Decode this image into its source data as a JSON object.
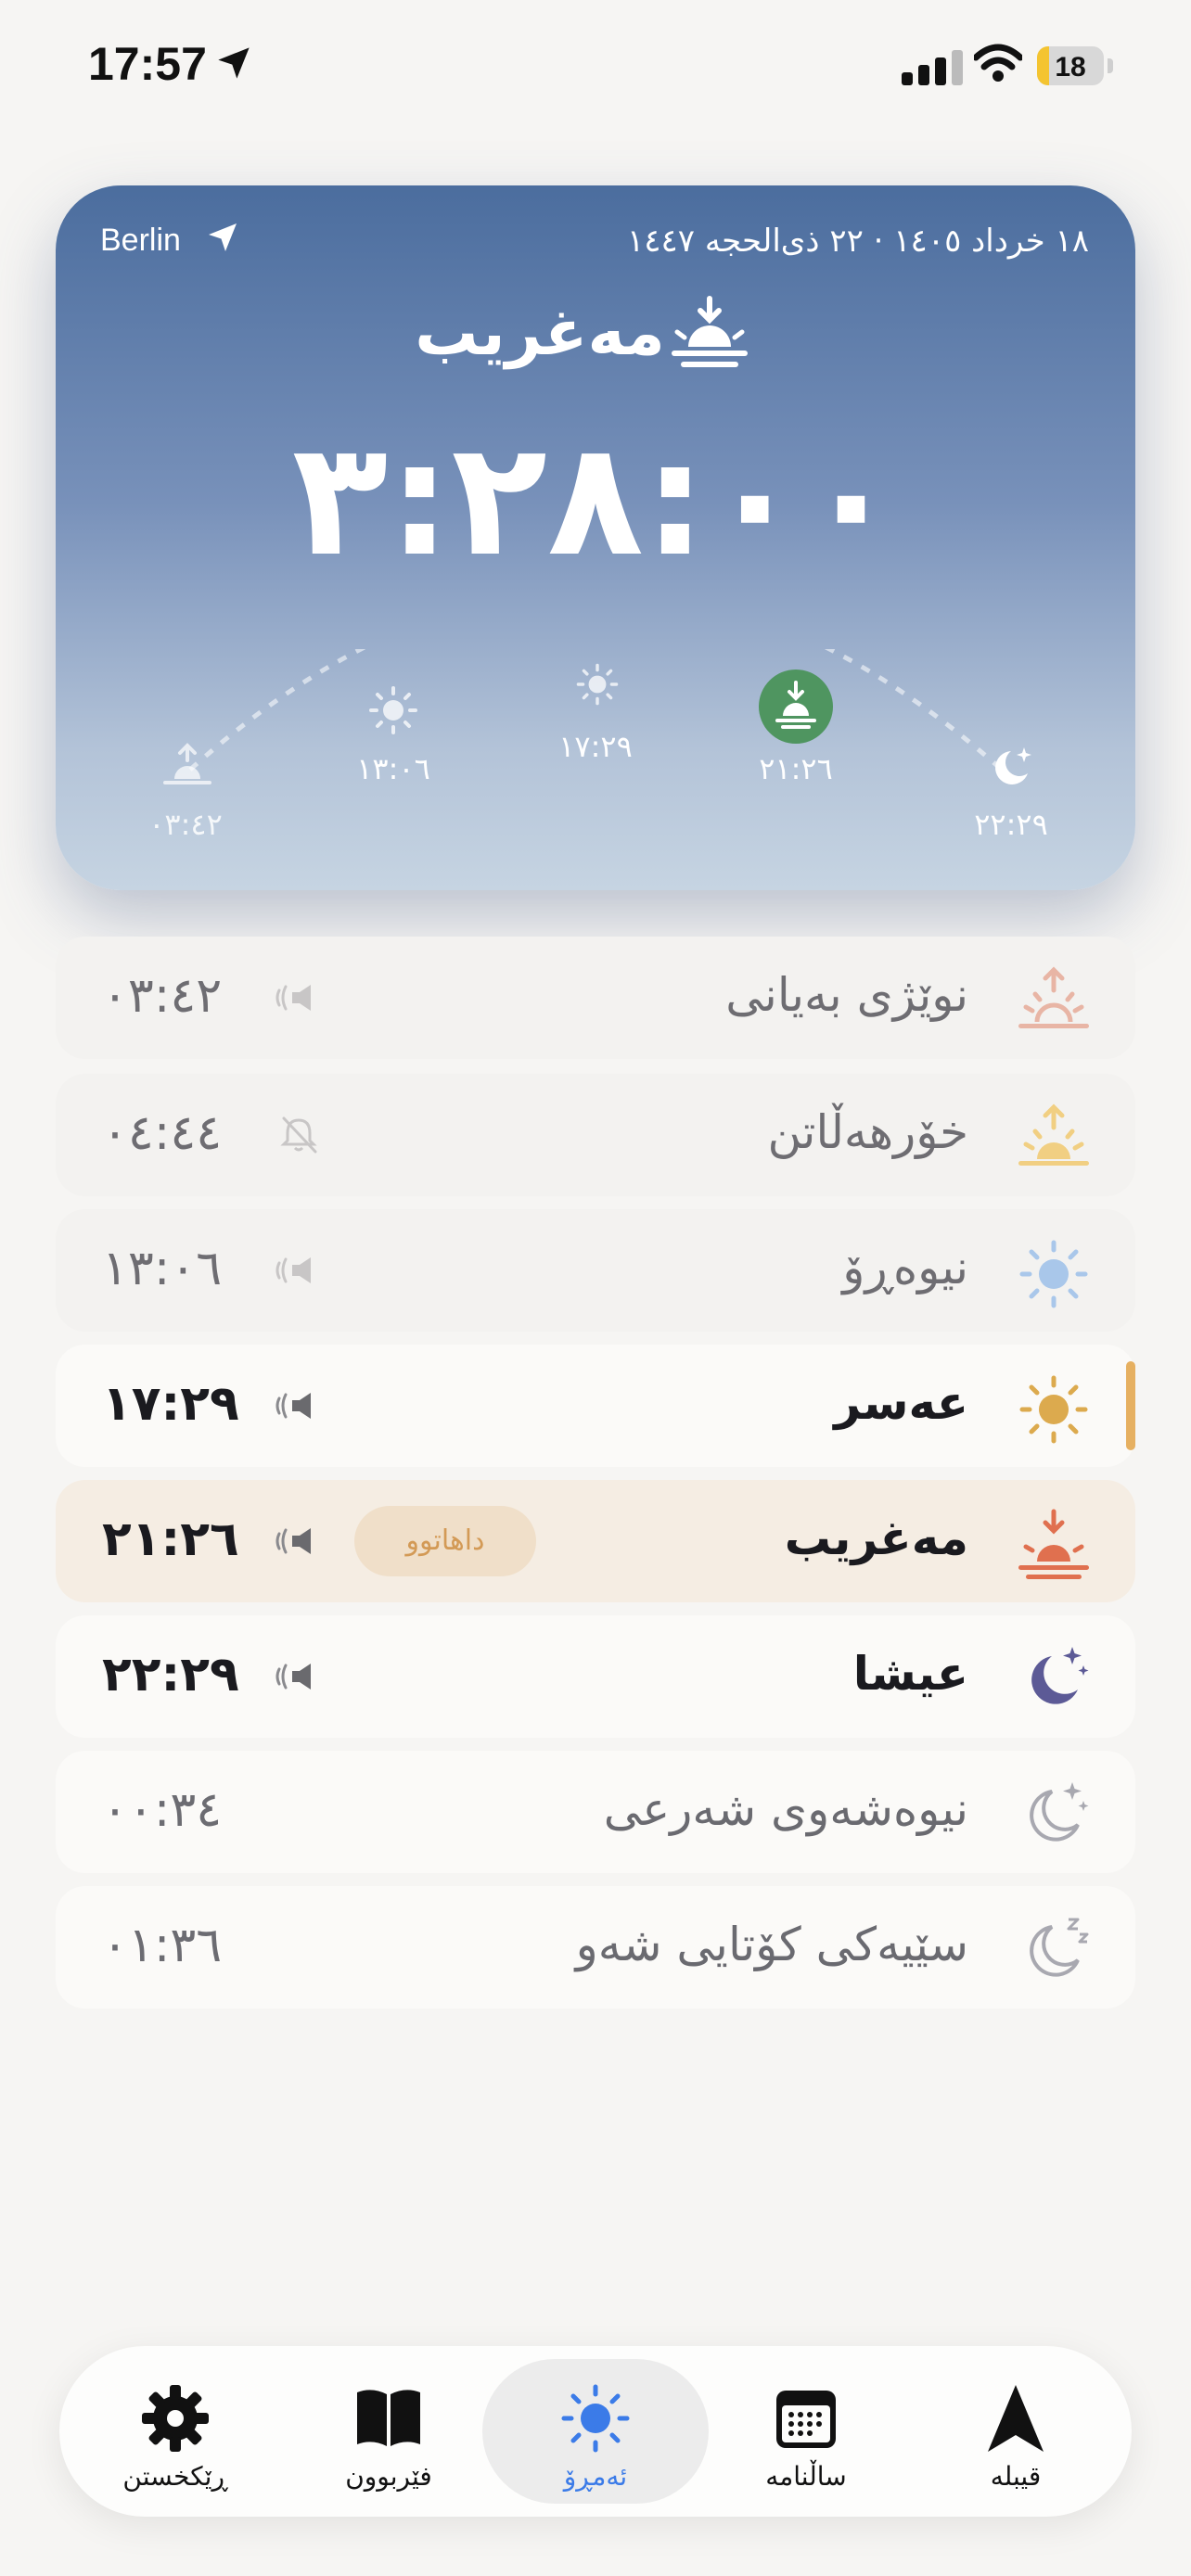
{
  "status_bar": {
    "time": "17:57",
    "battery": "18",
    "battery_level": 0.18
  },
  "hero": {
    "city": "Berlin",
    "date": "١٨ خرداد ١٤٠٥ · ٢٢ ذی‌الحجه ١٤٤٧",
    "current_prayer": "مەغریب",
    "countdown": "٣:٢٨:٠٠",
    "arc_times": [
      "٠٣:٤٢",
      "١٣:٠٦",
      "١٧:٢٩",
      "٢١:٢٦",
      "٢٢:٢٩"
    ]
  },
  "prayers": [
    {
      "name": "نوێژی بەیانی",
      "time": "٠٣:٤٢",
      "icon": "sunrise-icon",
      "icon_color": "#e8b5a5",
      "sound": "speaker-icon"
    },
    {
      "name": "خۆرهەڵاتن",
      "time": "٠٤:٤٤",
      "icon": "sunrise-icon",
      "icon_color": "#f1cf82",
      "sound": "bell-off-icon"
    },
    {
      "name": "نیوەڕۆ",
      "time": "١٣:٠٦",
      "icon": "sun-icon",
      "icon_color": "#a9c7ea",
      "sound": "speaker-icon"
    },
    {
      "name": "عەسر",
      "time": "١٧:٢٩",
      "icon": "sun-icon",
      "icon_color": "#dcaa4e",
      "sound": "speaker-icon"
    },
    {
      "name": "مەغریب",
      "time": "٢١:٢٦",
      "icon": "sunset-icon",
      "icon_color": "#e0704f",
      "sound": "speaker-icon",
      "badge": "داهاتوو"
    },
    {
      "name": "عیشا",
      "time": "٢٢:٢٩",
      "icon": "moon-stars-icon",
      "icon_color": "#5c5a96",
      "sound": "speaker-icon"
    },
    {
      "name": "نیوەشەوی شەرعی",
      "time": "٠٠:٣٤",
      "icon": "moon-stars-icon",
      "icon_color": "#a8a8b0"
    },
    {
      "name": "سێیەکی کۆتایی شەو",
      "time": "٠١:٣٦",
      "icon": "moon-zzz-icon",
      "icon_color": "#a8a8b0"
    }
  ],
  "tabs": [
    {
      "label": "ڕێکخستن",
      "icon": "gear-icon"
    },
    {
      "label": "فێربوون",
      "icon": "book-icon"
    },
    {
      "label": "ئەمڕۆ",
      "icon": "sun-icon"
    },
    {
      "label": "ساڵنامە",
      "icon": "calendar-icon"
    },
    {
      "label": "قیبلە",
      "icon": "qibla-arrow-icon"
    }
  ],
  "colors": {
    "accent_blue": "#3b7be8",
    "accent_orange": "#e6b061",
    "current_green": "#4f9560"
  }
}
